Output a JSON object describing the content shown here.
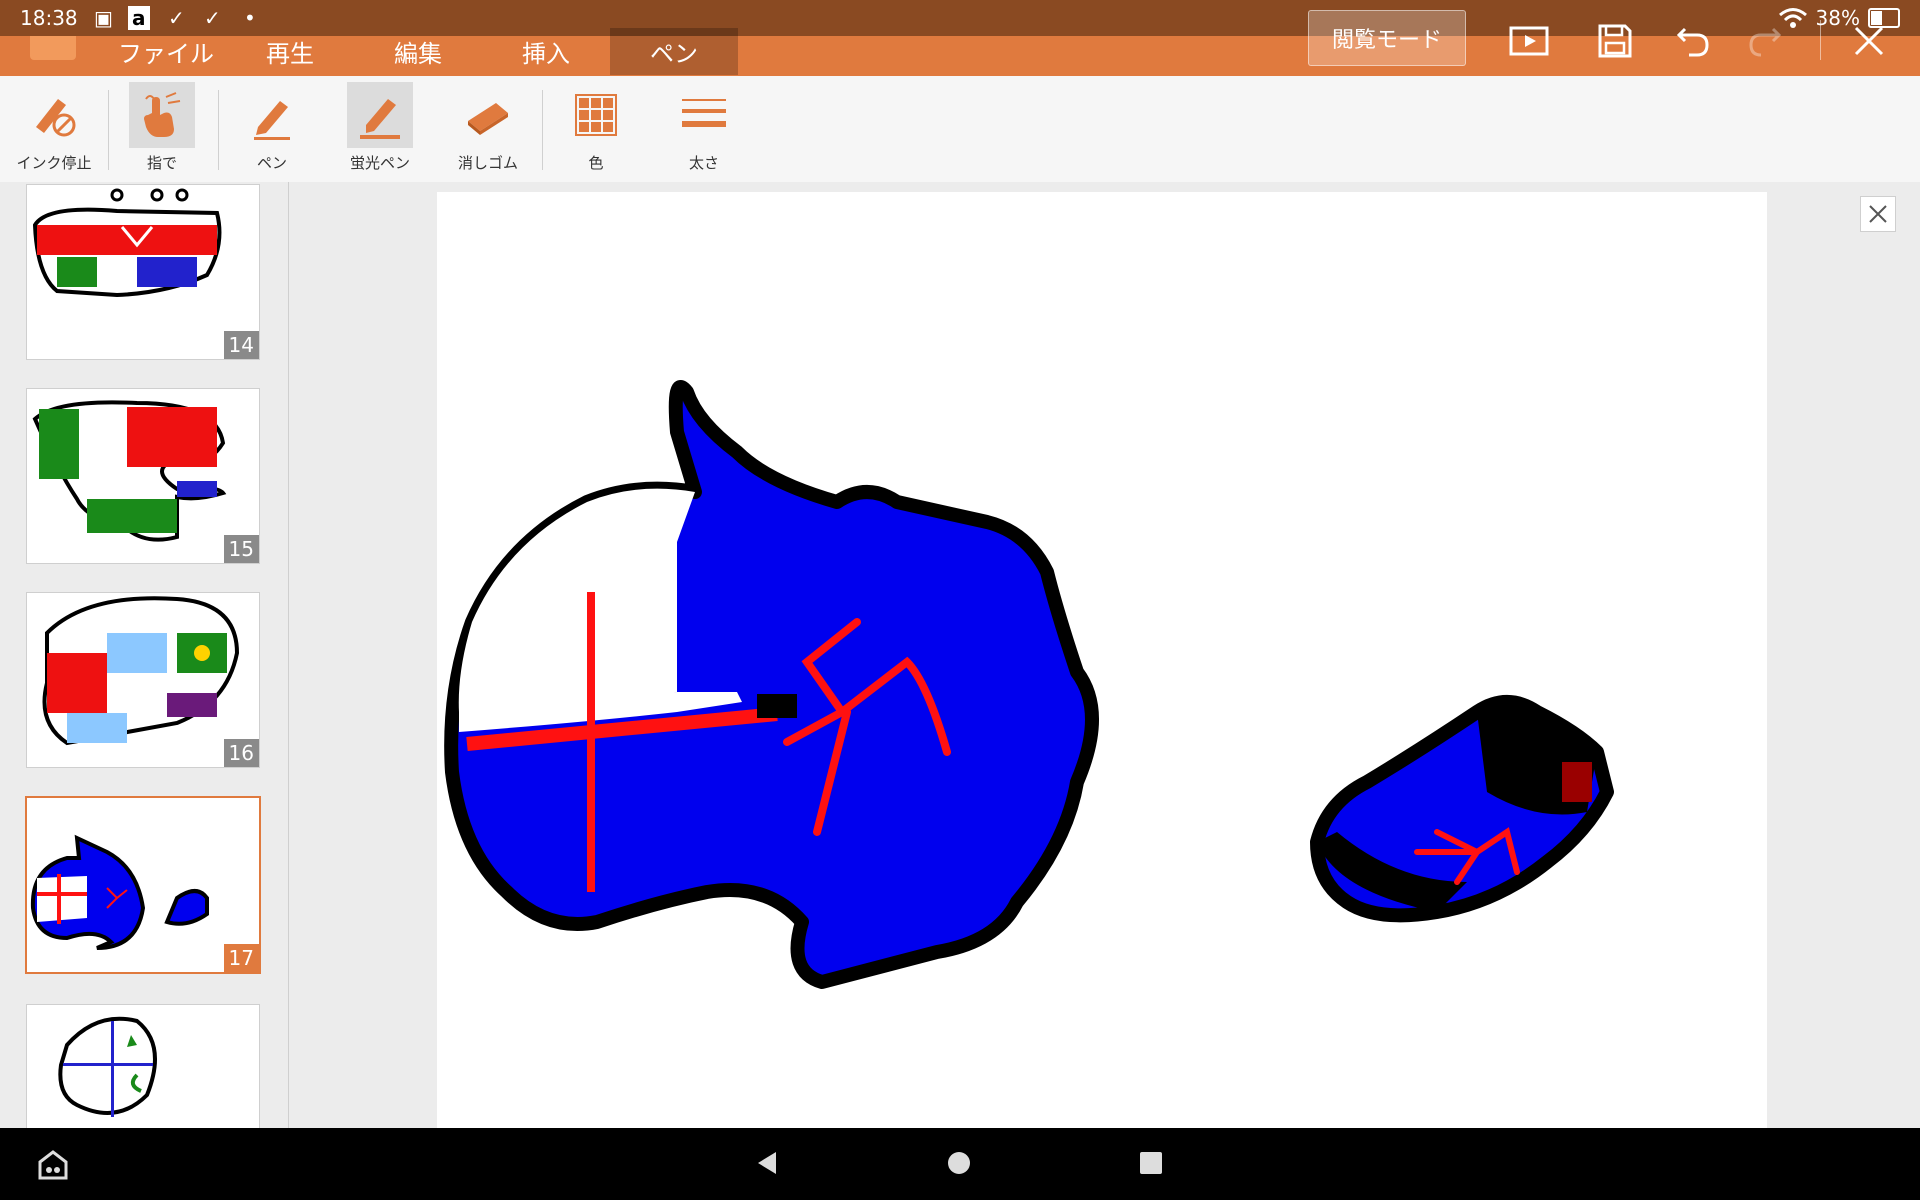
{
  "status": {
    "time": "18:38",
    "battery": "38%"
  },
  "title": {
    "menus": [
      "ファイル",
      "再生",
      "編集",
      "挿入",
      "ペン"
    ],
    "active_menu": "ペン",
    "read_mode": "閲覧モード"
  },
  "toolbar": {
    "ink_stop": "インク停止",
    "finger": "指で",
    "pen": "ペン",
    "highlighter": "蛍光ペン",
    "eraser": "消しゴム",
    "color": "色",
    "thickness": "太さ"
  },
  "slides": {
    "numbers": [
      "14",
      "15",
      "16",
      "17"
    ],
    "selected": "17"
  },
  "colors": {
    "accent": "#e07a3e",
    "status_bar": "#8a4a22",
    "drawing_blue": "#0000ee",
    "drawing_red": "#ff1a1a"
  }
}
